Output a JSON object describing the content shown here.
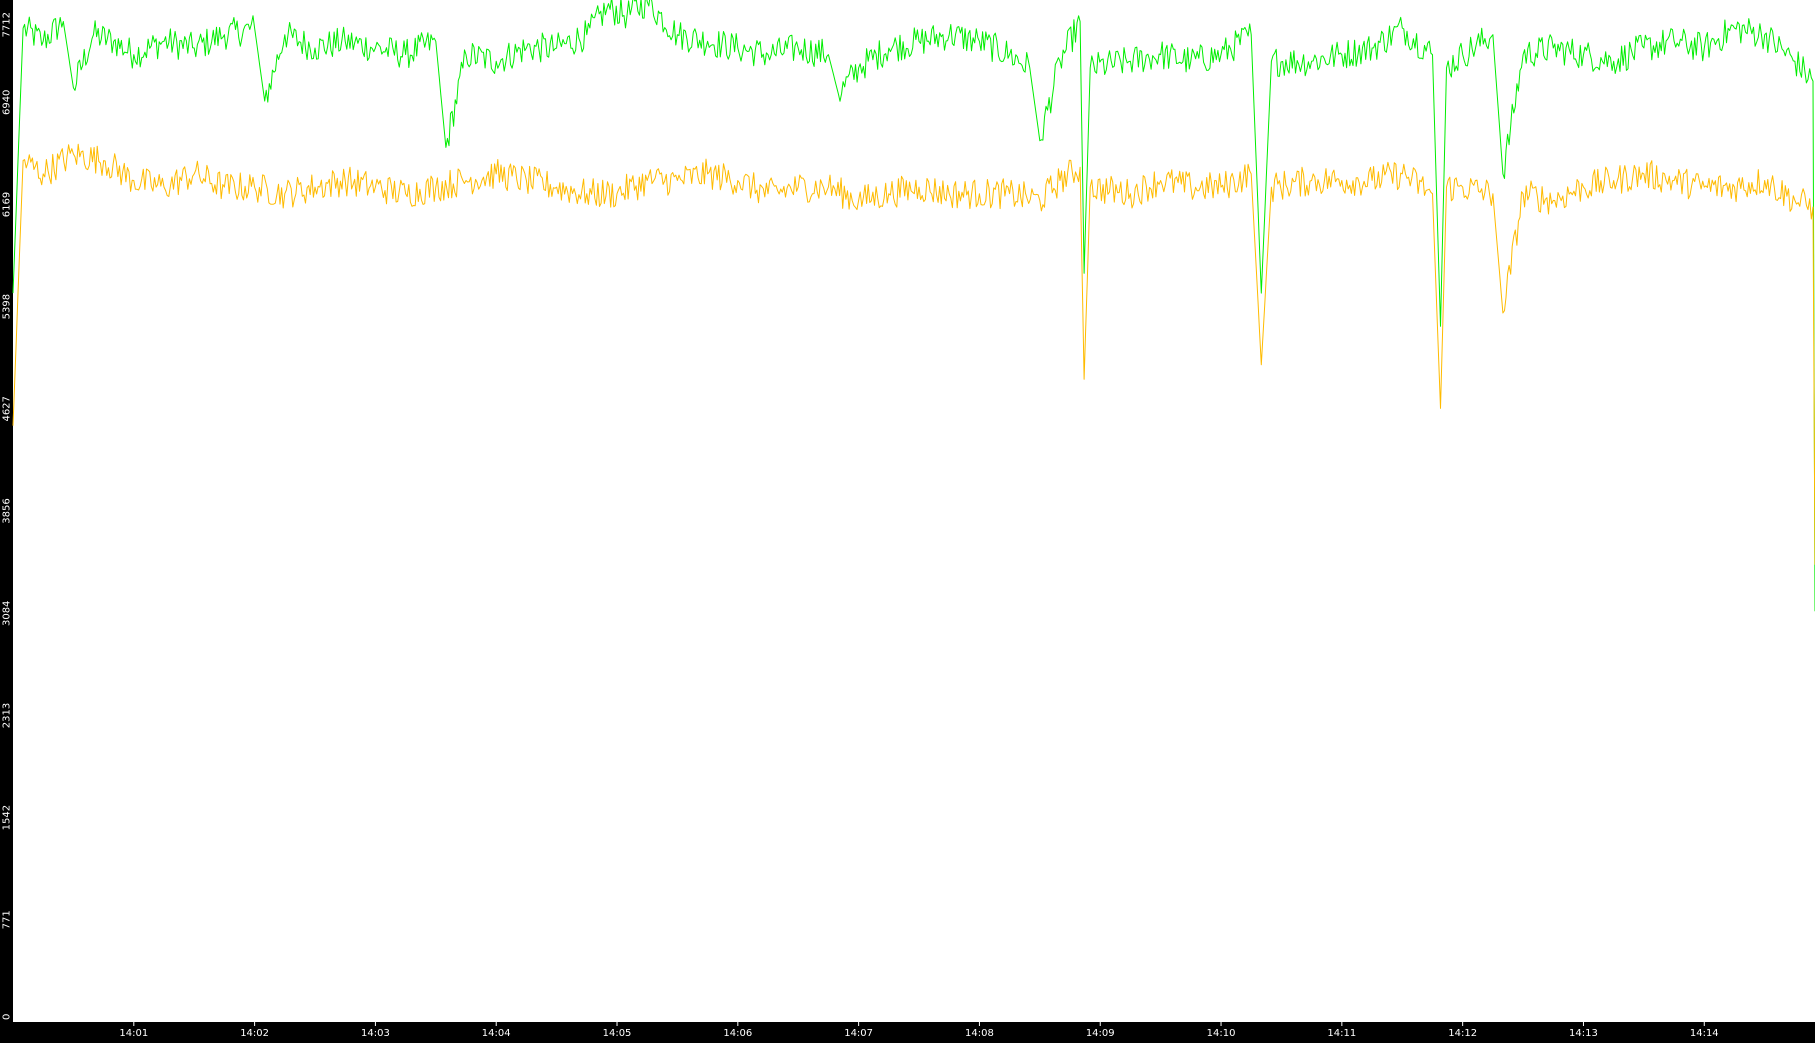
{
  "colors": {
    "background": "#000000",
    "plot_area": "#ffffff",
    "axis_text": "#ffffff",
    "series_green": "#00ee00",
    "series_yellow": "#ffbb00"
  },
  "chart_data": {
    "type": "line",
    "title": "",
    "xlabel": "",
    "ylabel": "",
    "grid": false,
    "legend": "none",
    "ylim": [
      0,
      7712
    ],
    "y_ticks": [
      "0",
      "771",
      "1542",
      "2313",
      "3084",
      "3856",
      "4627",
      "5398",
      "6169",
      "6940",
      "7712"
    ],
    "x_range": [
      "14:00:00",
      "14:14:55"
    ],
    "x_ticks": [
      "14:01",
      "14:02",
      "14:03",
      "14:04",
      "14:05",
      "14:06",
      "14:07",
      "14:08",
      "14:09",
      "14:10",
      "14:11",
      "14:12",
      "14:13",
      "14:14"
    ],
    "series": [
      {
        "color": "#00ee00",
        "points": [
          [
            "14:00:00",
            5500
          ],
          [
            "14:00:05",
            7500
          ],
          [
            "14:00:15",
            7400
          ],
          [
            "14:00:25",
            7550
          ],
          [
            "14:00:30",
            7050
          ],
          [
            "14:00:40",
            7450
          ],
          [
            "14:00:50",
            7400
          ],
          [
            "14:01:00",
            7300
          ],
          [
            "14:01:15",
            7400
          ],
          [
            "14:01:30",
            7350
          ],
          [
            "14:01:45",
            7450
          ],
          [
            "14:02:00",
            7500
          ],
          [
            "14:02:05",
            6950
          ],
          [
            "14:02:15",
            7450
          ],
          [
            "14:02:30",
            7350
          ],
          [
            "14:02:45",
            7400
          ],
          [
            "14:03:00",
            7350
          ],
          [
            "14:03:15",
            7300
          ],
          [
            "14:03:30",
            7400
          ],
          [
            "14:03:35",
            6600
          ],
          [
            "14:03:45",
            7300
          ],
          [
            "14:04:00",
            7250
          ],
          [
            "14:04:15",
            7350
          ],
          [
            "14:04:30",
            7350
          ],
          [
            "14:04:45",
            7450
          ],
          [
            "14:04:55",
            7650
          ],
          [
            "14:05:05",
            7600
          ],
          [
            "14:05:15",
            7700
          ],
          [
            "14:05:30",
            7450
          ],
          [
            "14:05:45",
            7400
          ],
          [
            "14:06:00",
            7350
          ],
          [
            "14:06:15",
            7300
          ],
          [
            "14:06:30",
            7350
          ],
          [
            "14:06:45",
            7300
          ],
          [
            "14:06:50",
            7000
          ],
          [
            "14:07:00",
            7200
          ],
          [
            "14:07:15",
            7350
          ],
          [
            "14:07:30",
            7400
          ],
          [
            "14:07:45",
            7450
          ],
          [
            "14:08:00",
            7400
          ],
          [
            "14:08:15",
            7300
          ],
          [
            "14:08:25",
            7200
          ],
          [
            "14:08:30",
            6650
          ],
          [
            "14:08:40",
            7250
          ],
          [
            "14:08:50",
            7550
          ],
          [
            "14:08:52",
            5650
          ],
          [
            "14:08:55",
            7200
          ],
          [
            "14:09:15",
            7250
          ],
          [
            "14:09:30",
            7300
          ],
          [
            "14:09:45",
            7250
          ],
          [
            "14:10:00",
            7300
          ],
          [
            "14:10:15",
            7450
          ],
          [
            "14:10:20",
            5500
          ],
          [
            "14:10:25",
            7250
          ],
          [
            "14:10:45",
            7250
          ],
          [
            "14:11:00",
            7300
          ],
          [
            "14:11:15",
            7350
          ],
          [
            "14:11:30",
            7500
          ],
          [
            "14:11:45",
            7300
          ],
          [
            "14:11:49",
            5250
          ],
          [
            "14:11:52",
            7200
          ],
          [
            "14:12:00",
            7300
          ],
          [
            "14:12:15",
            7450
          ],
          [
            "14:12:20",
            6400
          ],
          [
            "14:12:30",
            7300
          ],
          [
            "14:12:45",
            7350
          ],
          [
            "14:13:00",
            7300
          ],
          [
            "14:13:15",
            7250
          ],
          [
            "14:13:30",
            7350
          ],
          [
            "14:13:45",
            7400
          ],
          [
            "14:14:00",
            7350
          ],
          [
            "14:14:15",
            7500
          ],
          [
            "14:14:30",
            7450
          ],
          [
            "14:14:45",
            7250
          ],
          [
            "14:14:54",
            7100
          ],
          [
            "14:14:55",
            3100
          ]
        ]
      },
      {
        "color": "#ffbb00",
        "points": [
          [
            "14:00:00",
            4500
          ],
          [
            "14:00:05",
            6500
          ],
          [
            "14:00:15",
            6400
          ],
          [
            "14:00:30",
            6550
          ],
          [
            "14:00:45",
            6500
          ],
          [
            "14:01:00",
            6350
          ],
          [
            "14:01:15",
            6300
          ],
          [
            "14:01:30",
            6400
          ],
          [
            "14:01:45",
            6300
          ],
          [
            "14:02:00",
            6300
          ],
          [
            "14:02:15",
            6250
          ],
          [
            "14:02:30",
            6300
          ],
          [
            "14:02:45",
            6350
          ],
          [
            "14:03:00",
            6300
          ],
          [
            "14:03:15",
            6250
          ],
          [
            "14:03:30",
            6300
          ],
          [
            "14:03:45",
            6350
          ],
          [
            "14:04:00",
            6400
          ],
          [
            "14:04:15",
            6350
          ],
          [
            "14:04:30",
            6300
          ],
          [
            "14:04:45",
            6250
          ],
          [
            "14:05:00",
            6250
          ],
          [
            "14:05:15",
            6350
          ],
          [
            "14:05:30",
            6350
          ],
          [
            "14:05:45",
            6400
          ],
          [
            "14:06:00",
            6350
          ],
          [
            "14:06:15",
            6250
          ],
          [
            "14:06:30",
            6300
          ],
          [
            "14:06:45",
            6300
          ],
          [
            "14:07:00",
            6200
          ],
          [
            "14:07:15",
            6250
          ],
          [
            "14:07:30",
            6300
          ],
          [
            "14:07:45",
            6250
          ],
          [
            "14:08:00",
            6250
          ],
          [
            "14:08:15",
            6250
          ],
          [
            "14:08:30",
            6200
          ],
          [
            "14:08:40",
            6350
          ],
          [
            "14:08:50",
            6450
          ],
          [
            "14:08:52",
            4850
          ],
          [
            "14:08:55",
            6300
          ],
          [
            "14:09:15",
            6250
          ],
          [
            "14:09:30",
            6350
          ],
          [
            "14:09:45",
            6300
          ],
          [
            "14:10:00",
            6300
          ],
          [
            "14:10:15",
            6400
          ],
          [
            "14:10:20",
            4960
          ],
          [
            "14:10:25",
            6300
          ],
          [
            "14:10:45",
            6350
          ],
          [
            "14:11:00",
            6350
          ],
          [
            "14:11:15",
            6350
          ],
          [
            "14:11:30",
            6400
          ],
          [
            "14:11:45",
            6250
          ],
          [
            "14:11:49",
            4630
          ],
          [
            "14:11:52",
            6300
          ],
          [
            "14:12:00",
            6300
          ],
          [
            "14:12:15",
            6250
          ],
          [
            "14:12:20",
            5350
          ],
          [
            "14:12:30",
            6250
          ],
          [
            "14:12:45",
            6200
          ],
          [
            "14:13:00",
            6300
          ],
          [
            "14:13:15",
            6350
          ],
          [
            "14:13:30",
            6400
          ],
          [
            "14:13:45",
            6350
          ],
          [
            "14:14:00",
            6300
          ],
          [
            "14:14:15",
            6300
          ],
          [
            "14:14:30",
            6350
          ],
          [
            "14:14:45",
            6200
          ],
          [
            "14:14:54",
            6150
          ],
          [
            "14:14:55",
            3450
          ]
        ]
      }
    ]
  }
}
